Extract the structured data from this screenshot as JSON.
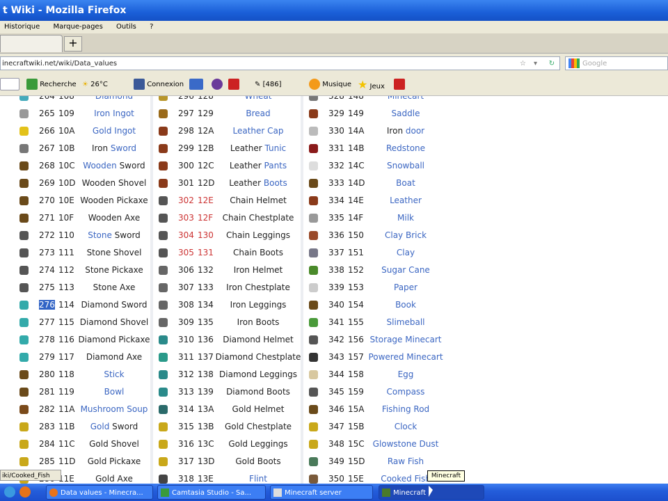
{
  "window": {
    "title": "t Wiki - Mozilla Firefox"
  },
  "menu": [
    "Historique",
    "Marque-pages",
    "Outils",
    "?"
  ],
  "newtab": "+",
  "url": "inecraftwiki.net/wiki/Data_values",
  "search_placeholder": "Google",
  "toolbar": {
    "recherche": "Recherche",
    "weather": "26°C",
    "connexion": "Connexion",
    "counter": "[486]",
    "musique": "Musique",
    "jeux": "Jeux"
  },
  "status_text": "iki/Cooked_Fish",
  "tooltip": "Minecraft",
  "colors": {
    "link": "#3b66c2",
    "red_link": "#cc3333",
    "taskbar": "#245edb"
  },
  "columns": [
    {
      "rows": [
        {
          "dec": "264",
          "hex": "108",
          "name": "Diamond",
          "style": "blue",
          "icon": "#4ab"
        },
        {
          "dec": "265",
          "hex": "109",
          "name": "Iron Ingot",
          "style": "blue",
          "icon": "#999"
        },
        {
          "dec": "266",
          "hex": "10A",
          "name": "Gold Ingot",
          "style": "blue",
          "icon": "#e3c21a"
        },
        {
          "dec": "267",
          "hex": "10B",
          "name": "Iron Sword",
          "style": "mixed",
          "pre": "Iron ",
          "link": "Sword",
          "icon": "#777"
        },
        {
          "dec": "268",
          "hex": "10C",
          "name": "Wooden Sword",
          "style": "mixed2",
          "pre": "Wooden",
          "link": " Sword",
          "icon": "#6a4a1a"
        },
        {
          "dec": "269",
          "hex": "10D",
          "name": "Wooden Shovel",
          "style": "plain",
          "icon": "#6a4a1a"
        },
        {
          "dec": "270",
          "hex": "10E",
          "name": "Wooden Pickaxe",
          "style": "plain",
          "icon": "#6a4a1a"
        },
        {
          "dec": "271",
          "hex": "10F",
          "name": "Wooden Axe",
          "style": "plain",
          "icon": "#6a4a1a"
        },
        {
          "dec": "272",
          "hex": "110",
          "name": "Stone Sword",
          "style": "mixed2",
          "pre": "Stone",
          "link": " Sword",
          "icon": "#555"
        },
        {
          "dec": "273",
          "hex": "111",
          "name": "Stone Shovel",
          "style": "plain",
          "icon": "#555"
        },
        {
          "dec": "274",
          "hex": "112",
          "name": "Stone Pickaxe",
          "style": "plain",
          "icon": "#555"
        },
        {
          "dec": "275",
          "hex": "113",
          "name": "Stone Axe",
          "style": "plain",
          "icon": "#555"
        },
        {
          "dec": "276",
          "hex": "114",
          "name": "Diamond Sword",
          "style": "plain",
          "hl": true,
          "icon": "#3aa"
        },
        {
          "dec": "277",
          "hex": "115",
          "name": "Diamond Shovel",
          "style": "plain",
          "icon": "#3aa"
        },
        {
          "dec": "278",
          "hex": "116",
          "name": "Diamond Pickaxe",
          "style": "plain",
          "icon": "#3aa"
        },
        {
          "dec": "279",
          "hex": "117",
          "name": "Diamond Axe",
          "style": "plain",
          "icon": "#3aa"
        },
        {
          "dec": "280",
          "hex": "118",
          "name": "Stick",
          "style": "blue",
          "icon": "#6a4a1a"
        },
        {
          "dec": "281",
          "hex": "119",
          "name": "Bowl",
          "style": "blue",
          "icon": "#6a4a1a"
        },
        {
          "dec": "282",
          "hex": "11A",
          "name": "Mushroom Soup",
          "style": "blue",
          "icon": "#7a4a1a"
        },
        {
          "dec": "283",
          "hex": "11B",
          "name": "Gold Sword",
          "style": "mixed2",
          "pre": "Gold",
          "link": " Sword",
          "icon": "#c9a81a"
        },
        {
          "dec": "284",
          "hex": "11C",
          "name": "Gold Shovel",
          "style": "plain",
          "icon": "#c9a81a"
        },
        {
          "dec": "285",
          "hex": "11D",
          "name": "Gold Pickaxe",
          "style": "plain",
          "icon": "#c9a81a"
        },
        {
          "dec": "286",
          "hex": "11E",
          "name": "Gold Axe",
          "style": "plain",
          "icon": "#c9a81a"
        }
      ]
    },
    {
      "rows": [
        {
          "dec": "296",
          "hex": "128",
          "name": "Wheat",
          "style": "blue",
          "icon": "#b8962a"
        },
        {
          "dec": "297",
          "hex": "129",
          "name": "Bread",
          "style": "blue",
          "icon": "#9a6a1a"
        },
        {
          "dec": "298",
          "hex": "12A",
          "name": "Leather Cap",
          "style": "blue",
          "icon": "#8a3a1a"
        },
        {
          "dec": "299",
          "hex": "12B",
          "name": "Leather Tunic",
          "style": "mixed",
          "pre": "Leather ",
          "link": "Tunic",
          "icon": "#8a3a1a"
        },
        {
          "dec": "300",
          "hex": "12C",
          "name": "Leather Pants",
          "style": "mixed",
          "pre": "Leather ",
          "link": "Pants",
          "icon": "#8a3a1a"
        },
        {
          "dec": "301",
          "hex": "12D",
          "name": "Leather Boots",
          "style": "mixed",
          "pre": "Leather ",
          "link": "Boots",
          "icon": "#8a3a1a"
        },
        {
          "dec": "302",
          "hex": "12E",
          "name": "Chain Helmet",
          "style": "plain",
          "red": true,
          "icon": "#555"
        },
        {
          "dec": "303",
          "hex": "12F",
          "name": "Chain Chestplate",
          "style": "plain",
          "red": true,
          "icon": "#555"
        },
        {
          "dec": "304",
          "hex": "130",
          "name": "Chain Leggings",
          "style": "plain",
          "red": true,
          "icon": "#555"
        },
        {
          "dec": "305",
          "hex": "131",
          "name": "Chain Boots",
          "style": "plain",
          "red": true,
          "icon": "#555"
        },
        {
          "dec": "306",
          "hex": "132",
          "name": "Iron Helmet",
          "style": "plain",
          "icon": "#666"
        },
        {
          "dec": "307",
          "hex": "133",
          "name": "Iron Chestplate",
          "style": "plain",
          "icon": "#666"
        },
        {
          "dec": "308",
          "hex": "134",
          "name": "Iron Leggings",
          "style": "plain",
          "icon": "#666"
        },
        {
          "dec": "309",
          "hex": "135",
          "name": "Iron Boots",
          "style": "plain",
          "icon": "#666"
        },
        {
          "dec": "310",
          "hex": "136",
          "name": "Diamond Helmet",
          "style": "plain",
          "icon": "#2a8a8a"
        },
        {
          "dec": "311",
          "hex": "137",
          "name": "Diamond Chestplate",
          "style": "plain",
          "icon": "#2a9a8a"
        },
        {
          "dec": "312",
          "hex": "138",
          "name": "Diamond Leggings",
          "style": "plain",
          "icon": "#2a8a8a"
        },
        {
          "dec": "313",
          "hex": "139",
          "name": "Diamond Boots",
          "style": "plain",
          "icon": "#2a8a8a"
        },
        {
          "dec": "314",
          "hex": "13A",
          "name": "Gold Helmet",
          "style": "plain",
          "icon": "#2a6a6a"
        },
        {
          "dec": "315",
          "hex": "13B",
          "name": "Gold Chestplate",
          "style": "plain",
          "icon": "#c9a81a"
        },
        {
          "dec": "316",
          "hex": "13C",
          "name": "Gold Leggings",
          "style": "plain",
          "icon": "#c9a81a"
        },
        {
          "dec": "317",
          "hex": "13D",
          "name": "Gold Boots",
          "style": "plain",
          "icon": "#c9a81a"
        },
        {
          "dec": "318",
          "hex": "13E",
          "name": "Flint",
          "style": "blue",
          "icon": "#444"
        }
      ]
    },
    {
      "rows": [
        {
          "dec": "328",
          "hex": "148",
          "name": "Minecart",
          "style": "blue",
          "icon": "#777"
        },
        {
          "dec": "329",
          "hex": "149",
          "name": "Saddle",
          "style": "blue",
          "icon": "#8a3a1a"
        },
        {
          "dec": "330",
          "hex": "14A",
          "name": "Iron door",
          "style": "mixed",
          "pre": "Iron ",
          "link": "door",
          "icon": "#bbb"
        },
        {
          "dec": "331",
          "hex": "14B",
          "name": "Redstone",
          "style": "blue",
          "icon": "#8a1a1a"
        },
        {
          "dec": "332",
          "hex": "14C",
          "name": "Snowball",
          "style": "blue",
          "icon": "#ddd"
        },
        {
          "dec": "333",
          "hex": "14D",
          "name": "Boat",
          "style": "blue",
          "icon": "#6a4a1a"
        },
        {
          "dec": "334",
          "hex": "14E",
          "name": "Leather",
          "style": "blue",
          "icon": "#8a3a1a"
        },
        {
          "dec": "335",
          "hex": "14F",
          "name": "Milk",
          "style": "blue",
          "icon": "#999"
        },
        {
          "dec": "336",
          "hex": "150",
          "name": "Clay Brick",
          "style": "blue",
          "icon": "#9a4a2a"
        },
        {
          "dec": "337",
          "hex": "151",
          "name": "Clay",
          "style": "blue",
          "icon": "#778"
        },
        {
          "dec": "338",
          "hex": "152",
          "name": "Sugar Cane",
          "style": "blue",
          "icon": "#4a8a2a"
        },
        {
          "dec": "339",
          "hex": "153",
          "name": "Paper",
          "style": "blue",
          "icon": "#ccc"
        },
        {
          "dec": "340",
          "hex": "154",
          "name": "Book",
          "style": "blue",
          "icon": "#6a4a1a"
        },
        {
          "dec": "341",
          "hex": "155",
          "name": "Slimeball",
          "style": "blue",
          "icon": "#4a9a3a"
        },
        {
          "dec": "342",
          "hex": "156",
          "name": "Storage Minecart",
          "style": "blue",
          "icon": "#555"
        },
        {
          "dec": "343",
          "hex": "157",
          "name": "Powered Minecart",
          "style": "blue",
          "icon": "#333"
        },
        {
          "dec": "344",
          "hex": "158",
          "name": "Egg",
          "style": "blue",
          "icon": "#d8c8a0"
        },
        {
          "dec": "345",
          "hex": "159",
          "name": "Compass",
          "style": "blue",
          "icon": "#555"
        },
        {
          "dec": "346",
          "hex": "15A",
          "name": "Fishing Rod",
          "style": "blue",
          "icon": "#6a4a1a"
        },
        {
          "dec": "347",
          "hex": "15B",
          "name": "Clock",
          "style": "blue",
          "icon": "#c9a81a"
        },
        {
          "dec": "348",
          "hex": "15C",
          "name": "Glowstone Dust",
          "style": "blue",
          "icon": "#c9a81a"
        },
        {
          "dec": "349",
          "hex": "15D",
          "name": "Raw Fish",
          "style": "blue",
          "icon": "#4a7a5a"
        },
        {
          "dec": "350",
          "hex": "15E",
          "name": "Cooked Fish",
          "style": "blue",
          "icon": "#7a5a3a"
        }
      ]
    }
  ],
  "taskbar": {
    "buttons": [
      {
        "label": "Data values - Minecra...",
        "active": false
      },
      {
        "label": "Camtasia Studio - Sa...",
        "active": false
      },
      {
        "label": "Minecraft server",
        "active": false
      },
      {
        "label": "Minecraft",
        "active": true
      }
    ]
  }
}
